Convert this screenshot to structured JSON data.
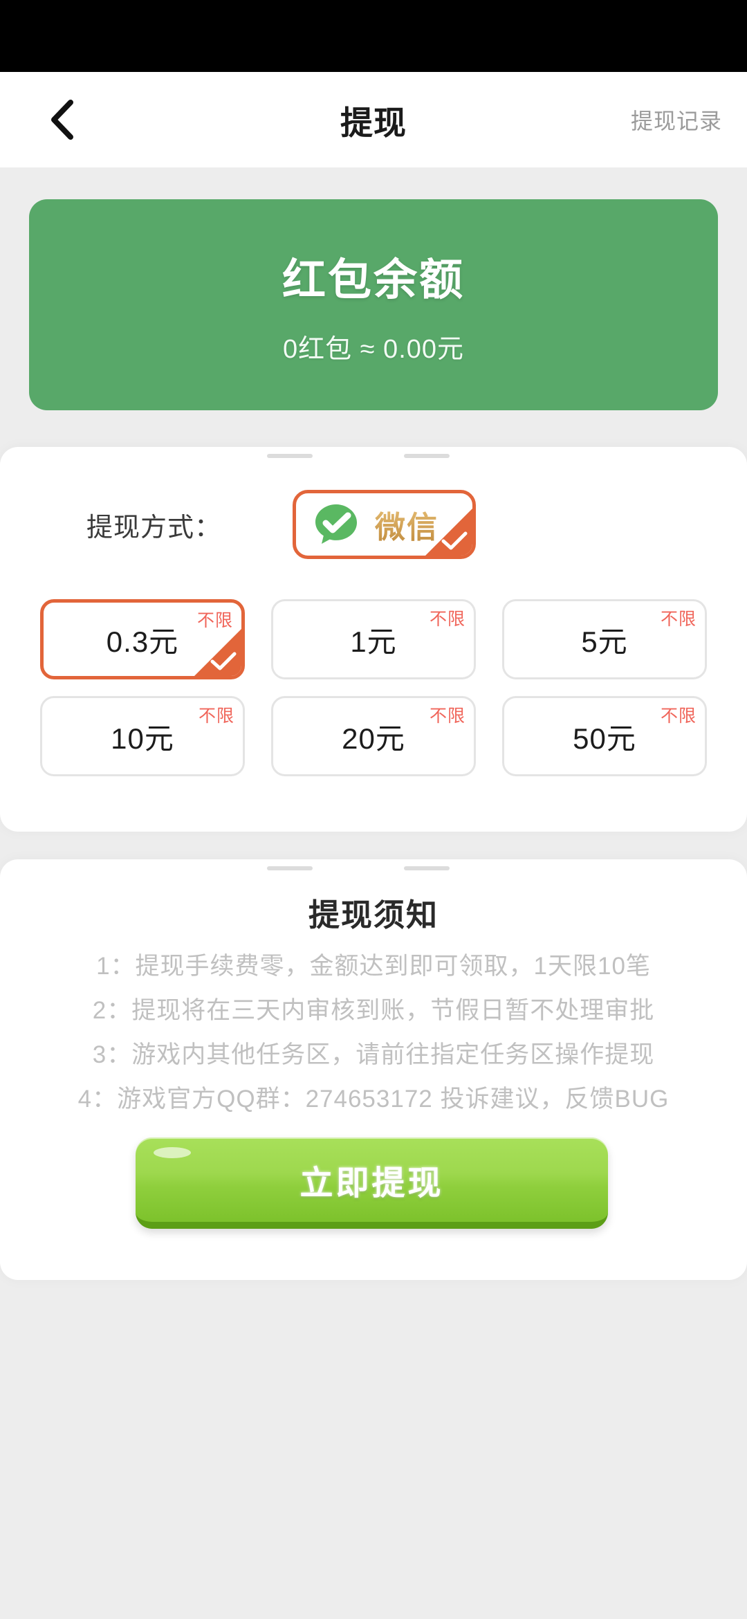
{
  "colors": {
    "page_bg": "#ededed",
    "card_bg": "#ffffff",
    "balance_green": "#58a869",
    "accent_orange": "#e2653a",
    "badge_red": "#f0655a",
    "button_green": "#8fcf3d",
    "muted_text": "#c0c0c0"
  },
  "nav": {
    "back_icon": "chevron-left-icon",
    "title": "提现",
    "records_label": "提现记录"
  },
  "balance": {
    "title": "红包余额",
    "summary": "0红包 ≈ 0.00元"
  },
  "method": {
    "label": "提现方式：",
    "options": [
      {
        "name": "微信",
        "icon": "wechat-icon",
        "selected": true
      }
    ]
  },
  "amounts": {
    "badge_label": "不限",
    "items": [
      {
        "value": "0.3元",
        "badge": "不限",
        "selected": true
      },
      {
        "value": "1元",
        "badge": "不限",
        "selected": false
      },
      {
        "value": "5元",
        "badge": "不限",
        "selected": false
      },
      {
        "value": "10元",
        "badge": "不限",
        "selected": false
      },
      {
        "value": "20元",
        "badge": "不限",
        "selected": false
      },
      {
        "value": "50元",
        "badge": "不限",
        "selected": false
      }
    ]
  },
  "notice": {
    "title": "提现须知",
    "items": [
      "1：提现手续费零，金额达到即可领取，1天限10笔",
      "2：提现将在三天内审核到账，节假日暂不处理审批",
      "3：游戏内其他任务区，请前往指定任务区操作提现",
      "4：游戏官方QQ群：274653172 投诉建议，反馈BUG"
    ]
  },
  "submit": {
    "label": "立即提现"
  }
}
